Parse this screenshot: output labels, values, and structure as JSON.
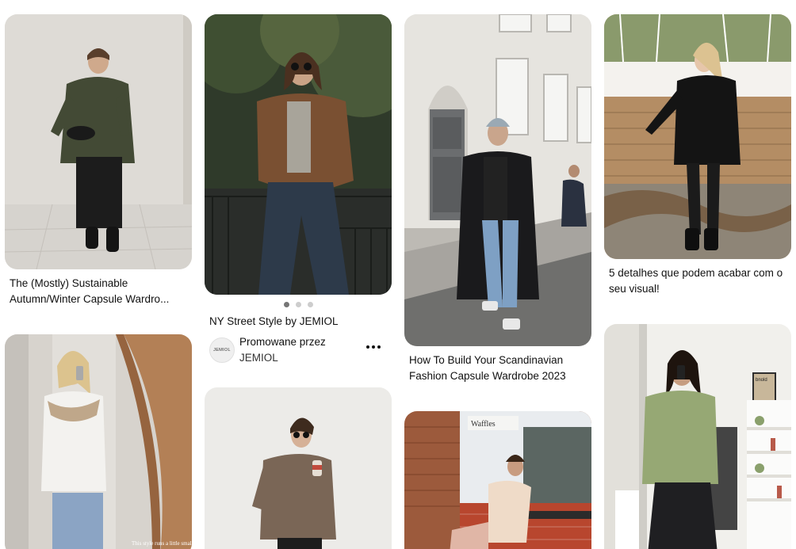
{
  "pins": {
    "p1": {
      "title": "The (Mostly) Sustainable Autumn/Winter Capsule Wardro..."
    },
    "p2": {
      "title": "NY Street Style by JEMIOL",
      "carousel": {
        "count": 3,
        "active_index": 0
      },
      "promoted_label": "Promowane przez",
      "promoted_by": "JEMIOL",
      "avatar_text": "JEMIOL",
      "more_icon": "ellipsis-icon"
    },
    "p3": {
      "title": "How To Build Your Scandinavian Fashion Capsule Wardrobe 2023"
    },
    "p4": {
      "title": "5 detalhes que podem acabar com o seu visual!"
    },
    "p5": {
      "overlay_caption": "This style runs a little small"
    },
    "p6": {},
    "p7": {
      "storefront_sign": "Waffles"
    },
    "p8": {
      "poster_text": "bnold"
    }
  },
  "colors": {
    "background": "#ffffff",
    "text": "#111111",
    "dot_active": "#767676",
    "dot_inactive": "#cdcdcd"
  }
}
